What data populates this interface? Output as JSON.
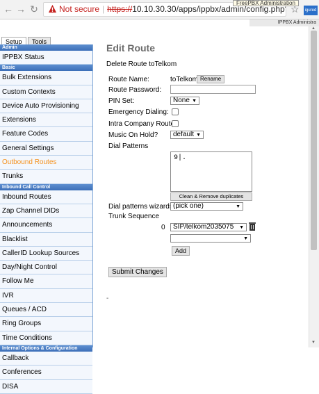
{
  "browser": {
    "not_secure": "Not secure",
    "scheme": "https://",
    "url_rest": "10.10.30.30/apps/ippbx/admin/config.php?dis",
    "tooltip": "FreePBX Administration",
    "ext_label": "igured",
    "back_icon": "arrow-left",
    "forward_icon": "arrow-right",
    "reload_icon": "reload",
    "star_icon": "star"
  },
  "header": {
    "right_text": "IPPBX Administra"
  },
  "tabs": [
    {
      "label": "Setup"
    },
    {
      "label": "Tools"
    }
  ],
  "sidebar": {
    "sections": [
      {
        "header": "Admin",
        "items": [
          "IPPBX Status"
        ]
      },
      {
        "header": "Basic",
        "items": [
          "Bulk Extensions",
          "Custom Contexts",
          "Device Auto Provisioning",
          "Extensions",
          "Feature Codes",
          "General Settings",
          "Outbound Routes",
          "Trunks"
        ]
      },
      {
        "header": "Inbound Call Control",
        "items": [
          "Inbound Routes",
          "Zap Channel DIDs",
          "Announcements",
          "Blacklist",
          "CallerID Lookup Sources",
          "Day/Night Control",
          "Follow Me",
          "IVR",
          "Queues / ACD",
          "Ring Groups",
          "Time Conditions"
        ]
      },
      {
        "header": "Internal Options & Configuration",
        "items": [
          "Callback",
          "Conferences",
          "DISA"
        ]
      }
    ],
    "active_item": "Outbound Routes"
  },
  "page": {
    "title": "Edit Route",
    "delete_link": "Delete Route toTelkom",
    "route_name_label": "Route Name:",
    "route_name_value": "toTelkom",
    "rename_button": "Rename",
    "route_password_label": "Route Password:",
    "route_password_value": "",
    "pin_set_label": "PIN Set:",
    "pin_set_value": "None",
    "emergency_label": "Emergency Dialing:",
    "emergency_checked": false,
    "intra_company_label": "Intra Company Route:",
    "intra_company_checked": false,
    "music_on_hold_label": "Music On Hold?",
    "music_on_hold_value": "default",
    "dial_patterns_label": "Dial Patterns",
    "dial_patterns_value": "9|.",
    "clean_button": "Clean & Remove duplicates",
    "wizards_label": "Dial patterns wizards:",
    "wizards_value": "(pick one)",
    "trunk_sequence_label": "Trunk Sequence",
    "trunk_index": "0",
    "trunk_value": "SIP/telkom2035075",
    "trunk_empty_value": "",
    "add_button": "Add",
    "submit_button": "Submit Changes",
    "trailing_mark": "-"
  }
}
